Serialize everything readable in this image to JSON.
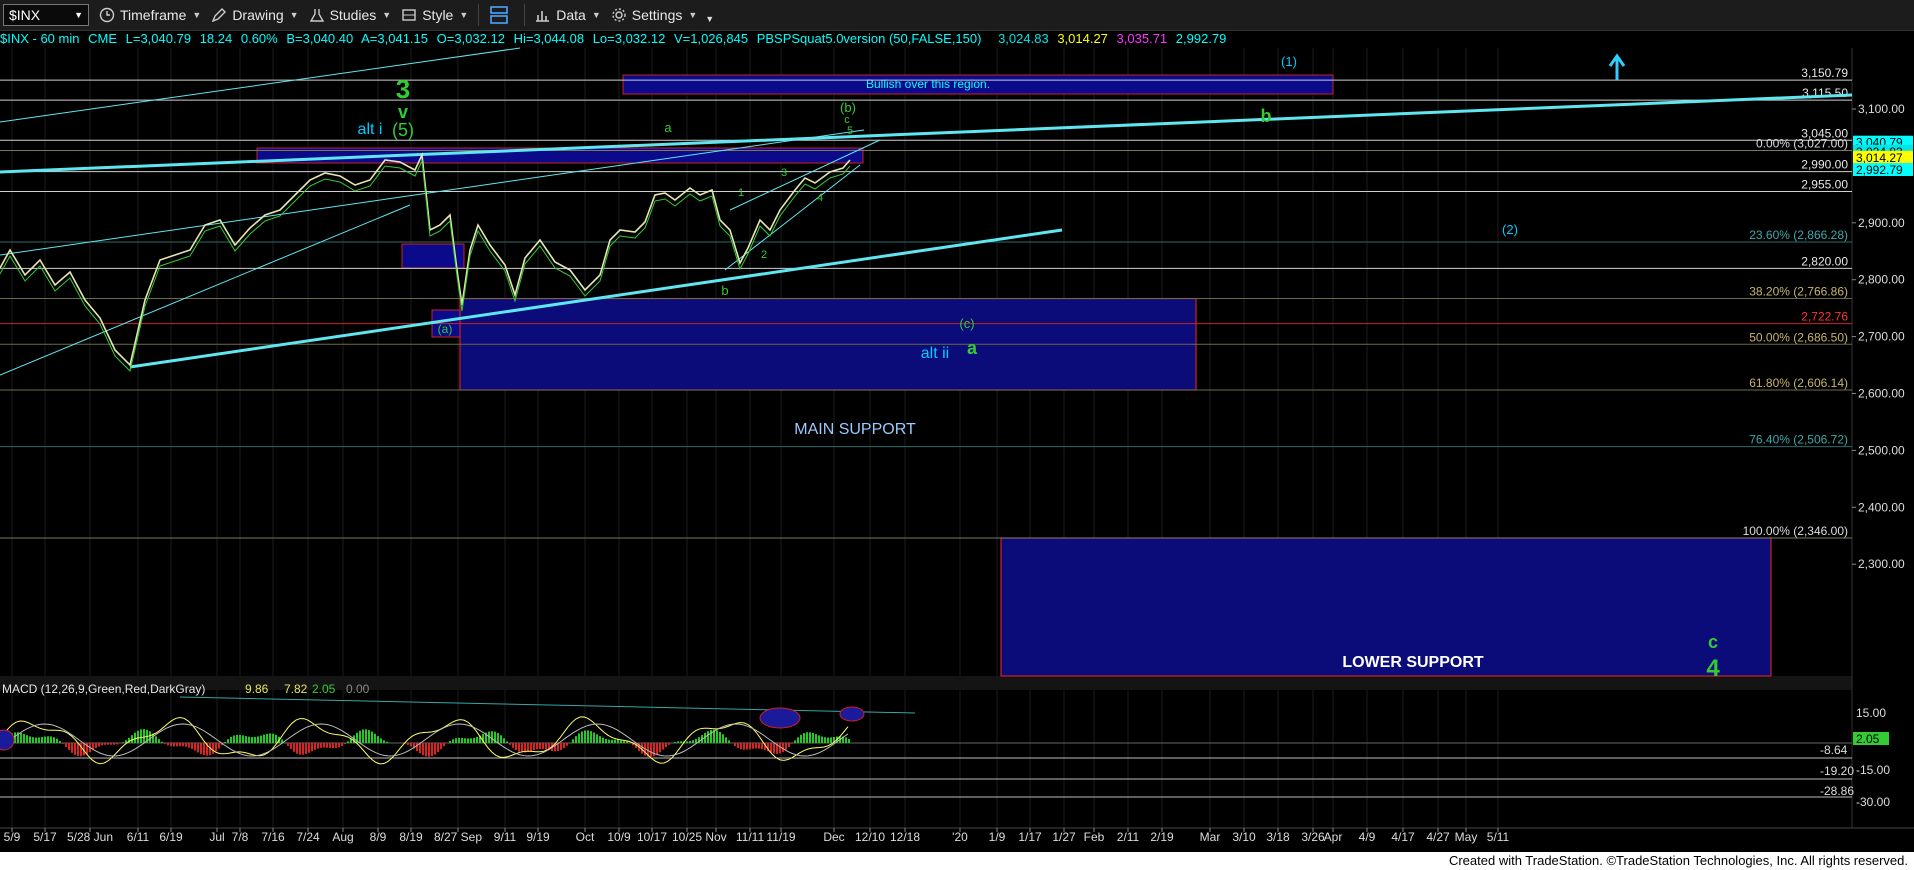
{
  "toolbar": {
    "symbol": "$INX",
    "items": [
      "Timeframe",
      "Drawing",
      "Studies",
      "Style",
      "Data",
      "Settings"
    ]
  },
  "info": {
    "symbol_line": "$INX - 60 min",
    "exchange": "CME",
    "last": "L=3,040.79",
    "change": "18.24",
    "pct": "0.60%",
    "bid": "B=3,040.40",
    "ask": "A=3,041.15",
    "open": "O=3,032.12",
    "high": "Hi=3,044.08",
    "low": "Lo=3,032.12",
    "volume": "V=1,026,845",
    "study": "PBSPSquat5.0version (50,FALSE,150)",
    "study_vals": [
      "3,024.83",
      "3,014.27",
      "3,035.71",
      "2,992.79"
    ]
  },
  "chart_data": {
    "type": "line",
    "price_axis": {
      "range": [
        2265,
        3170
      ],
      "ticks": [
        3100,
        2900,
        2800,
        2700,
        2600,
        2500,
        2400,
        2300
      ],
      "tick_labels": [
        "3,100.00",
        "2,900.00",
        "2,800.00",
        "2,700.00",
        "2,600.00",
        "2,500.00",
        "2,400.00",
        "2,300.00"
      ]
    },
    "x_labels": [
      "5/9",
      "5/17",
      "5/28 Jun",
      "6/11",
      "6/19",
      "Jul",
      "7/8",
      "7/16",
      "7/24",
      "Aug",
      "8/9",
      "8/19",
      "8/27 Sep",
      "9/11",
      "9/19",
      "Oct",
      "10/9",
      "10/17",
      "10/25",
      "Nov",
      "11/11",
      "11/19",
      "Dec",
      "12/10",
      "12/18",
      "'20",
      "1/9",
      "1/17",
      "1/27",
      "Feb",
      "2/11",
      "2/19",
      "Mar",
      "3/10",
      "3/18",
      "3/26",
      "Apr",
      "4/9",
      "4/17",
      "4/27",
      "May",
      "5/11"
    ],
    "levels": [
      {
        "value": 3150.79,
        "label": "3,150.79"
      },
      {
        "value": 3115.5,
        "label": "3,115.50"
      },
      {
        "value": 3045.0,
        "label": "3,045.00"
      },
      {
        "value": 3027.0,
        "label": "0.00% (3,027.00)"
      },
      {
        "value": 2990.0,
        "label": "2,990.00"
      },
      {
        "value": 2955.0,
        "label": "2,955.00"
      },
      {
        "value": 2866.28,
        "label": "23.60% (2,866.28)"
      },
      {
        "value": 2820.0,
        "label": "2,820.00"
      },
      {
        "value": 2766.86,
        "label": "38.20% (2,766.86)"
      },
      {
        "value": 2722.76,
        "label": "2,722.76"
      },
      {
        "value": 2686.5,
        "label": "50.00% (2,686.50)"
      },
      {
        "value": 2606.14,
        "label": "61.80% (2,606.14)"
      },
      {
        "value": 2506.72,
        "label": "76.40% (2,506.72)"
      },
      {
        "value": 2346.0,
        "label": "100.00% (2,346.00)"
      }
    ],
    "last_price_tags": [
      "3,040.79",
      "3,024.83",
      "3,014.27",
      "2,992.79"
    ],
    "zones": [
      {
        "label": "Bullish over this region.",
        "from": 3115.5,
        "to": 3150.79
      },
      {
        "label": "MAIN SUPPORT",
        "from": 2606.14,
        "to": 2766.86
      },
      {
        "label": "LOWER SUPPORT",
        "from": 2265,
        "to": 2346
      }
    ],
    "wave_labels": [
      "3",
      "v",
      "(5)",
      "alt i",
      "a",
      "(b)",
      "c",
      "5",
      "b",
      "(1)",
      "(2)",
      "(a)",
      "(c)",
      "a",
      "alt ii",
      "c",
      "4",
      "1",
      "2",
      "3",
      "4",
      "b"
    ],
    "macd": {
      "title": "MACD (12,26,9,Green,Red,DarkGray)",
      "values": [
        "9.86",
        "7.82",
        "2.05",
        "0.00"
      ],
      "ticks": [
        "15.00",
        "-8.64",
        "-15.00",
        "-19.20",
        "-28.86",
        "-30.00"
      ],
      "last_tag": "2.05"
    }
  },
  "footer": "Created with TradeStation. ©TradeStation Technologies, Inc. All rights reserved."
}
